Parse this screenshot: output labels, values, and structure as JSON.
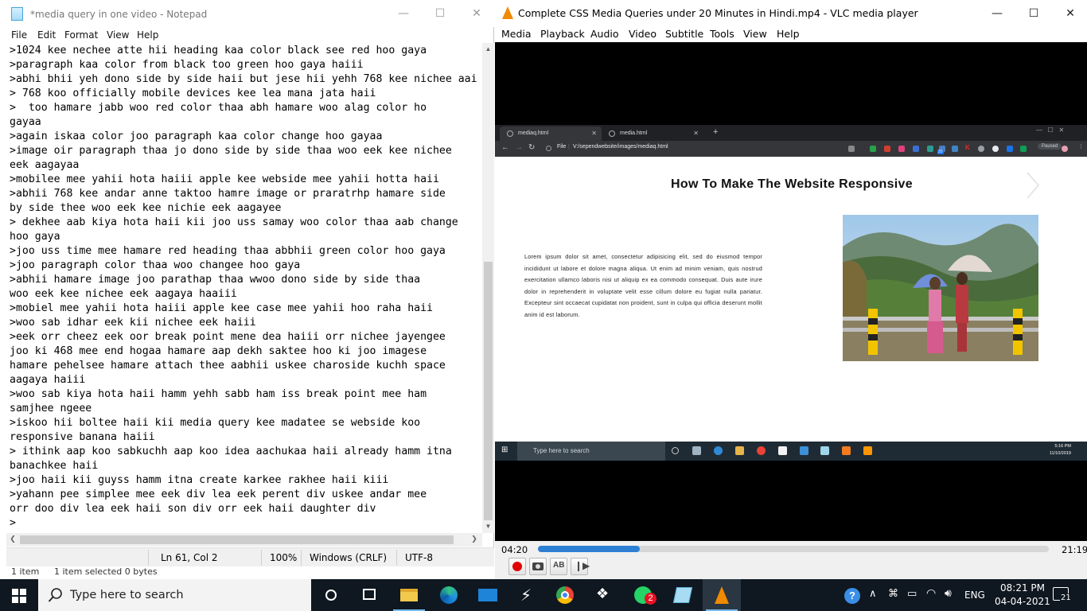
{
  "notepad": {
    "title": "*media query in one video - Notepad",
    "menu": [
      "File",
      "Edit",
      "Format",
      "View",
      "Help"
    ],
    "lines": [
      ">1024 kee nechee atte hii heading kaa color black see red hoo gaya",
      ">paragraph kaa color from black too green hoo gaya haiii",
      ">abhi bhii yeh dono side by side haii but jese hii yehh 768 kee nichee aai",
      "> 768 koo officially mobile devices kee lea mana jata haii",
      ">  too hamare jabb woo red color thaa abh hamare woo alag color ho",
      "gayaa",
      ">again iskaa color joo paragraph kaa color change hoo gayaa",
      ">image oir paragraph thaa jo dono side by side thaa woo eek kee nichee",
      "eek aagayaa",
      ">mobilee mee yahii hota haiii apple kee webside mee yahii hotta haii",
      ">abhii 768 kee andar anne taktoo hamre image or praratrhp hamare side",
      "by side thee woo eek kee nichie eek aagayee",
      "> dekhee aab kiya hota haii kii joo uss samay woo color thaa aab change",
      "hoo gaya",
      ">joo uss time mee hamare red heading thaa abbhii green color hoo gaya",
      ">joo paragraph color thaa woo changee hoo gaya",
      ">abhii hamare image joo parathap thaa wwoo dono side by side thaa",
      "woo eek kee nichee eek aagaya haaiii",
      ">mobiel mee yahii hota haiii apple kee case mee yahii hoo raha haii",
      ">woo sab idhar eek kii nichee eek haiii",
      ">eek orr cheez eek oor break point mene dea haiii orr nichee jayengee",
      "joo ki 468 mee end hogaa hamare aap dekh saktee hoo ki joo imagese",
      "hamare pehelsee hamare attach thee aabhii uskee charoside kuchh space",
      "aagaya haiii",
      ">woo sab kiya hota haii hamm yehh sabb ham iss break point mee ham",
      "samjhee ngeee",
      ">iskoo hii boltee haii kii media query kee madatee se webside koo",
      "responsive banana haiii",
      "> ithink aap koo sabkuchh aap koo idea aachukaa haii already hamm itna",
      "banachkee haii",
      ">joo haii kii guyss hamm itna create karkee rakhee haii kiii",
      ">yahann pee simplee mee eek div lea eek perent div uskee andar mee",
      "orr doo div lea eek haii son div orr eek haii daughter div",
      ">"
    ],
    "status": {
      "position": "Ln 61, Col 2",
      "zoom": "100%",
      "line_ending": "Windows (CRLF)",
      "encoding": "UTF-8"
    },
    "explorer_status": {
      "items": "1 item",
      "selected": "1 item selected  0 bytes"
    }
  },
  "vlc": {
    "title": "Complete CSS Media Queries under 20 Minutes in Hindi.mp4 - VLC media player",
    "menu": [
      "Media",
      "Playback",
      "Audio",
      "Video",
      "Subtitle",
      "Tools",
      "View",
      "Help"
    ],
    "time_elapsed": "04:20",
    "time_total": "21:19",
    "progress_fraction": 0.2,
    "accent": "#2d7fd3",
    "buttons": [
      "record-icon",
      "snapshot-icon",
      "loop-ab-icon",
      "frame-step-icon"
    ]
  },
  "video_frame": {
    "tabs": [
      "mediaq.html",
      "media.html"
    ],
    "address_scheme": "File",
    "address": "V:/sependwebsite/images/mediaq.html",
    "paused_label": "Paused",
    "ext_badge": "20",
    "heading": "How To Make The Website Responsive",
    "paragraph": "Lorem ipsum dolor sit amet, consectetur adipisicing elit, sed do eiusmod tempor incididunt ut labore et dolore magna aliqua. Ut enim ad minim veniam, quis nostrud exercitation ullamco laboris nisi ut aliquip ex ea commodo consequat. Duis aute irure dolor in reprehenderit in voluptate velit esse cillum dolore eu fugiat nulla pariatur. Excepteur sint occaecat cupidatat non proident, sunt in culpa qui officia deserunt mollit anim id est laborum.",
    "inner_search_placeholder": "Type here to search",
    "inner_clock_time": "5:16 PM",
    "inner_clock_date": "11/10/2019"
  },
  "taskbar": {
    "search_placeholder": "Type here to search",
    "whatsapp_badge": "2",
    "language": "ENG",
    "time": "08:21 PM",
    "date": "04-04-2021",
    "notification_count": "21"
  }
}
